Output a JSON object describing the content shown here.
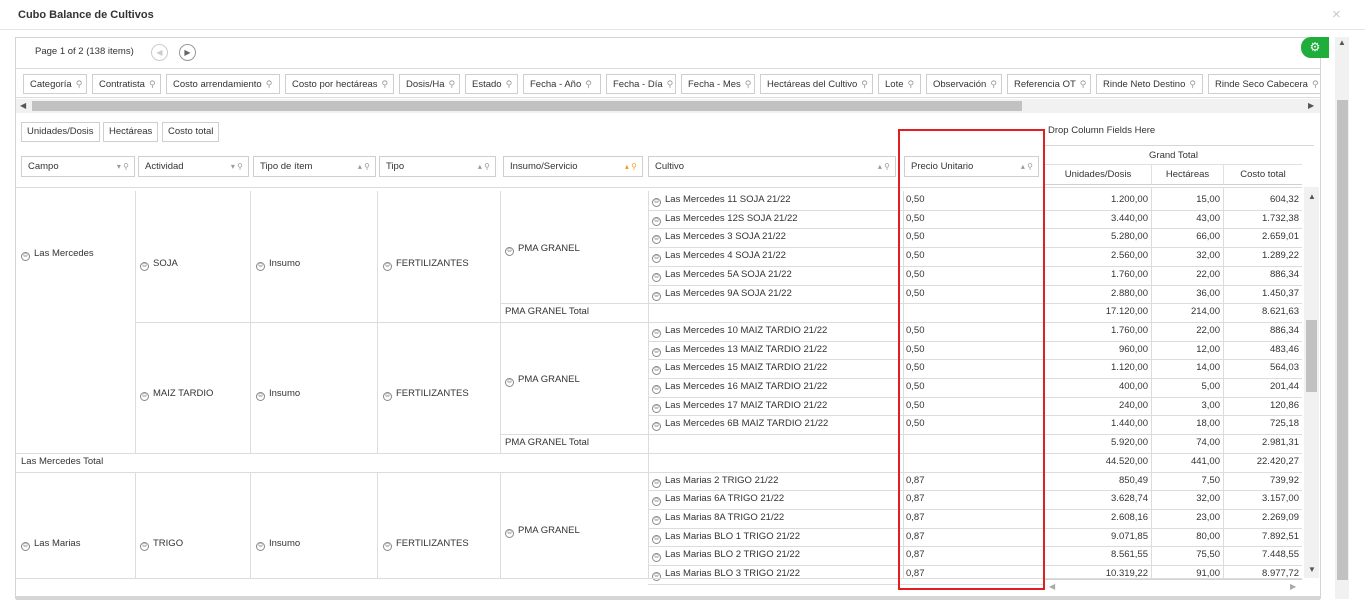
{
  "window": {
    "title": "Cubo Balance de Cultivos",
    "close_icon": "×"
  },
  "pager": {
    "text": "Page 1 of 2 (138 items)",
    "prev": "◀",
    "next": "▶"
  },
  "settings": {
    "icon": "gear-icon",
    "glyph": "⚙"
  },
  "filter_fields": [
    "Categoría",
    "Contratista",
    "Costo arrendamiento",
    "Costo por hectáreas",
    "Dosis/Ha",
    "Estado",
    "Fecha - Año",
    "Fecha - Día",
    "Fecha - Mes",
    "Hectáreas del Cultivo",
    "Lote",
    "Observación",
    "Referencia OT",
    "Rinde Neto Destino",
    "Rinde Seco Cabecera"
  ],
  "data_fields": [
    "Unidades/Dosis",
    "Hectáreas",
    "Costo total"
  ],
  "drop_column_text": "Drop Column Fields Here",
  "row_headers": [
    "Campo",
    "Actividad",
    "Tipo de ítem",
    "Tipo",
    "Insumo/Servicio",
    "Cultivo",
    "Precio Unitario"
  ],
  "grand_total_header": "Grand Total",
  "value_headers": [
    "Unidades/Dosis",
    "Hectáreas",
    "Costo total"
  ],
  "groups": {
    "campo1": "Las Mercedes",
    "campo1_total": "Las Mercedes Total",
    "campo2": "Las Marias",
    "act_soja": "SOJA",
    "act_maiz": "MAIZ TARDIO",
    "act_trigo": "TRIGO",
    "tipo_item": "Insumo",
    "tipo": "FERTILIZANTES",
    "insumo": "PMA GRANEL",
    "insumo_total": "PMA GRANEL Total"
  },
  "rows": [
    {
      "cultivo": "Las Mercedes 11 SOJA 21/22",
      "precio": "0,50",
      "unidades": "1.200,00",
      "hectareas": "15,00",
      "costo": "604,32"
    },
    {
      "cultivo": "Las Mercedes 12S SOJA 21/22",
      "precio": "0,50",
      "unidades": "3.440,00",
      "hectareas": "43,00",
      "costo": "1.732,38"
    },
    {
      "cultivo": "Las Mercedes 3 SOJA 21/22",
      "precio": "0,50",
      "unidades": "5.280,00",
      "hectareas": "66,00",
      "costo": "2.659,01"
    },
    {
      "cultivo": "Las Mercedes 4 SOJA 21/22",
      "precio": "0,50",
      "unidades": "2.560,00",
      "hectareas": "32,00",
      "costo": "1.289,22"
    },
    {
      "cultivo": "Las Mercedes 5A SOJA 21/22",
      "precio": "0,50",
      "unidades": "1.760,00",
      "hectareas": "22,00",
      "costo": "886,34"
    },
    {
      "cultivo": "Las Mercedes 9A SOJA 21/22",
      "precio": "0,50",
      "unidades": "2.880,00",
      "hectareas": "36,00",
      "costo": "1.450,37"
    },
    {
      "total": true,
      "unidades": "17.120,00",
      "hectareas": "214,00",
      "costo": "8.621,63"
    },
    {
      "cultivo": "Las Mercedes 10 MAIZ TARDIO 21/22",
      "precio": "0,50",
      "unidades": "1.760,00",
      "hectareas": "22,00",
      "costo": "886,34"
    },
    {
      "cultivo": "Las Mercedes 13 MAIZ TARDIO 21/22",
      "precio": "0,50",
      "unidades": "960,00",
      "hectareas": "12,00",
      "costo": "483,46"
    },
    {
      "cultivo": "Las Mercedes 15 MAIZ TARDIO 21/22",
      "precio": "0,50",
      "unidades": "1.120,00",
      "hectareas": "14,00",
      "costo": "564,03"
    },
    {
      "cultivo": "Las Mercedes 16 MAIZ TARDIO 21/22",
      "precio": "0,50",
      "unidades": "400,00",
      "hectareas": "5,00",
      "costo": "201,44"
    },
    {
      "cultivo": "Las Mercedes 17 MAIZ TARDIO 21/22",
      "precio": "0,50",
      "unidades": "240,00",
      "hectareas": "3,00",
      "costo": "120,86"
    },
    {
      "cultivo": "Las Mercedes 6B MAIZ TARDIO 21/22",
      "precio": "0,50",
      "unidades": "1.440,00",
      "hectareas": "18,00",
      "costo": "725,18"
    },
    {
      "total": true,
      "unidades": "5.920,00",
      "hectareas": "74,00",
      "costo": "2.981,31"
    },
    {
      "campo_total": true,
      "unidades": "44.520,00",
      "hectareas": "441,00",
      "costo": "22.420,27"
    },
    {
      "cultivo": "Las Marias 2 TRIGO 21/22",
      "precio": "0,87",
      "unidades": "850,49",
      "hectareas": "7,50",
      "costo": "739,92"
    },
    {
      "cultivo": "Las Marias 6A TRIGO 21/22",
      "precio": "0,87",
      "unidades": "3.628,74",
      "hectareas": "32,00",
      "costo": "3.157,00"
    },
    {
      "cultivo": "Las Marias 8A TRIGO 21/22",
      "precio": "0,87",
      "unidades": "2.608,16",
      "hectareas": "23,00",
      "costo": "2.269,09"
    },
    {
      "cultivo": "Las Marias BLO 1 TRIGO 21/22",
      "precio": "0,87",
      "unidades": "9.071,85",
      "hectareas": "80,00",
      "costo": "7.892,51"
    },
    {
      "cultivo": "Las Marias BLO 2 TRIGO 21/22",
      "precio": "0,87",
      "unidades": "8.561,55",
      "hectareas": "75,50",
      "costo": "7.448,55"
    },
    {
      "cultivo": "Las Marias BLO 3 TRIGO 21/22",
      "precio": "0,87",
      "unidades": "10.319,22",
      "hectareas": "91,00",
      "costo": "8.977,72"
    }
  ],
  "colors": {
    "highlight": "#e02020",
    "settings_bg": "#1fae3c",
    "filter_active": "#f0a020"
  }
}
